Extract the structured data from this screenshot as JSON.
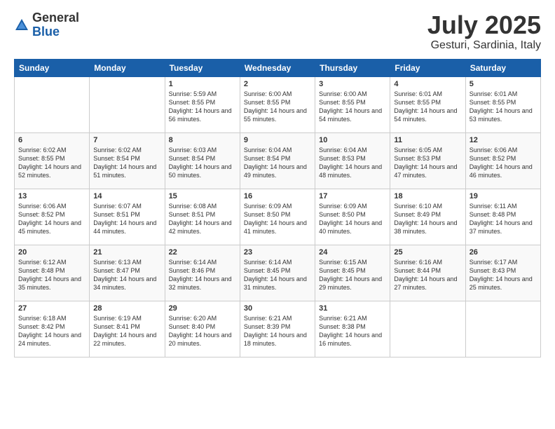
{
  "logo": {
    "general": "General",
    "blue": "Blue"
  },
  "title": {
    "month": "July 2025",
    "location": "Gesturi, Sardinia, Italy"
  },
  "weekdays": [
    "Sunday",
    "Monday",
    "Tuesday",
    "Wednesday",
    "Thursday",
    "Friday",
    "Saturday"
  ],
  "weeks": [
    [
      {
        "day": "",
        "info": ""
      },
      {
        "day": "",
        "info": ""
      },
      {
        "day": "1",
        "info": "Sunrise: 5:59 AM\nSunset: 8:55 PM\nDaylight: 14 hours and 56 minutes."
      },
      {
        "day": "2",
        "info": "Sunrise: 6:00 AM\nSunset: 8:55 PM\nDaylight: 14 hours and 55 minutes."
      },
      {
        "day": "3",
        "info": "Sunrise: 6:00 AM\nSunset: 8:55 PM\nDaylight: 14 hours and 54 minutes."
      },
      {
        "day": "4",
        "info": "Sunrise: 6:01 AM\nSunset: 8:55 PM\nDaylight: 14 hours and 54 minutes."
      },
      {
        "day": "5",
        "info": "Sunrise: 6:01 AM\nSunset: 8:55 PM\nDaylight: 14 hours and 53 minutes."
      }
    ],
    [
      {
        "day": "6",
        "info": "Sunrise: 6:02 AM\nSunset: 8:55 PM\nDaylight: 14 hours and 52 minutes."
      },
      {
        "day": "7",
        "info": "Sunrise: 6:02 AM\nSunset: 8:54 PM\nDaylight: 14 hours and 51 minutes."
      },
      {
        "day": "8",
        "info": "Sunrise: 6:03 AM\nSunset: 8:54 PM\nDaylight: 14 hours and 50 minutes."
      },
      {
        "day": "9",
        "info": "Sunrise: 6:04 AM\nSunset: 8:54 PM\nDaylight: 14 hours and 49 minutes."
      },
      {
        "day": "10",
        "info": "Sunrise: 6:04 AM\nSunset: 8:53 PM\nDaylight: 14 hours and 48 minutes."
      },
      {
        "day": "11",
        "info": "Sunrise: 6:05 AM\nSunset: 8:53 PM\nDaylight: 14 hours and 47 minutes."
      },
      {
        "day": "12",
        "info": "Sunrise: 6:06 AM\nSunset: 8:52 PM\nDaylight: 14 hours and 46 minutes."
      }
    ],
    [
      {
        "day": "13",
        "info": "Sunrise: 6:06 AM\nSunset: 8:52 PM\nDaylight: 14 hours and 45 minutes."
      },
      {
        "day": "14",
        "info": "Sunrise: 6:07 AM\nSunset: 8:51 PM\nDaylight: 14 hours and 44 minutes."
      },
      {
        "day": "15",
        "info": "Sunrise: 6:08 AM\nSunset: 8:51 PM\nDaylight: 14 hours and 42 minutes."
      },
      {
        "day": "16",
        "info": "Sunrise: 6:09 AM\nSunset: 8:50 PM\nDaylight: 14 hours and 41 minutes."
      },
      {
        "day": "17",
        "info": "Sunrise: 6:09 AM\nSunset: 8:50 PM\nDaylight: 14 hours and 40 minutes."
      },
      {
        "day": "18",
        "info": "Sunrise: 6:10 AM\nSunset: 8:49 PM\nDaylight: 14 hours and 38 minutes."
      },
      {
        "day": "19",
        "info": "Sunrise: 6:11 AM\nSunset: 8:48 PM\nDaylight: 14 hours and 37 minutes."
      }
    ],
    [
      {
        "day": "20",
        "info": "Sunrise: 6:12 AM\nSunset: 8:48 PM\nDaylight: 14 hours and 35 minutes."
      },
      {
        "day": "21",
        "info": "Sunrise: 6:13 AM\nSunset: 8:47 PM\nDaylight: 14 hours and 34 minutes."
      },
      {
        "day": "22",
        "info": "Sunrise: 6:14 AM\nSunset: 8:46 PM\nDaylight: 14 hours and 32 minutes."
      },
      {
        "day": "23",
        "info": "Sunrise: 6:14 AM\nSunset: 8:45 PM\nDaylight: 14 hours and 31 minutes."
      },
      {
        "day": "24",
        "info": "Sunrise: 6:15 AM\nSunset: 8:45 PM\nDaylight: 14 hours and 29 minutes."
      },
      {
        "day": "25",
        "info": "Sunrise: 6:16 AM\nSunset: 8:44 PM\nDaylight: 14 hours and 27 minutes."
      },
      {
        "day": "26",
        "info": "Sunrise: 6:17 AM\nSunset: 8:43 PM\nDaylight: 14 hours and 25 minutes."
      }
    ],
    [
      {
        "day": "27",
        "info": "Sunrise: 6:18 AM\nSunset: 8:42 PM\nDaylight: 14 hours and 24 minutes."
      },
      {
        "day": "28",
        "info": "Sunrise: 6:19 AM\nSunset: 8:41 PM\nDaylight: 14 hours and 22 minutes."
      },
      {
        "day": "29",
        "info": "Sunrise: 6:20 AM\nSunset: 8:40 PM\nDaylight: 14 hours and 20 minutes."
      },
      {
        "day": "30",
        "info": "Sunrise: 6:21 AM\nSunset: 8:39 PM\nDaylight: 14 hours and 18 minutes."
      },
      {
        "day": "31",
        "info": "Sunrise: 6:21 AM\nSunset: 8:38 PM\nDaylight: 14 hours and 16 minutes."
      },
      {
        "day": "",
        "info": ""
      },
      {
        "day": "",
        "info": ""
      }
    ]
  ]
}
